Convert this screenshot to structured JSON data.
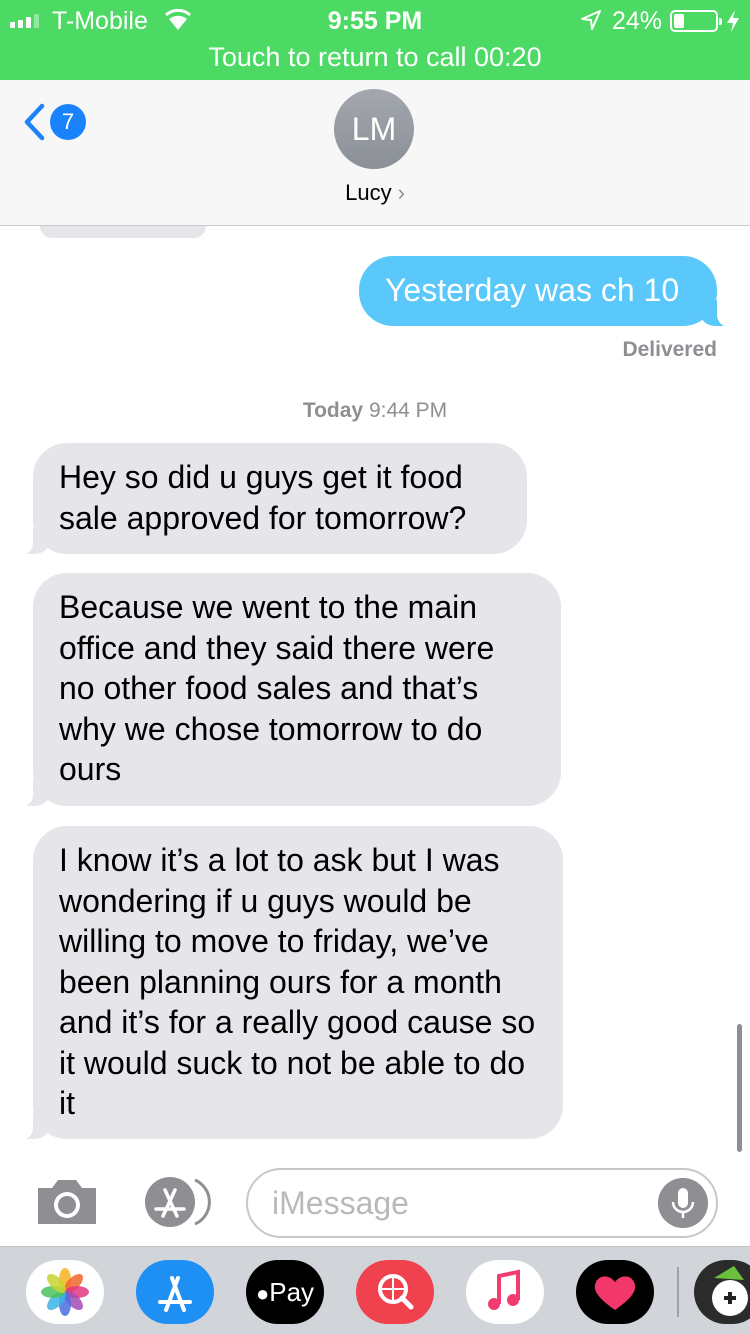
{
  "status_bar": {
    "carrier": "T-Mobile",
    "time": "9:55 PM",
    "battery_percent": "24%",
    "battery_level": 0.24,
    "signal_bars": 3,
    "charging": true
  },
  "call_banner": {
    "text": "Touch to return to call 00:20"
  },
  "header": {
    "back_badge_count": "7",
    "avatar_initials": "LM",
    "contact_name": "Lucy",
    "contact_chevron": "›"
  },
  "messages": {
    "outgoing_1": "Yesterday was ch 10",
    "delivered_status": "Delivered",
    "date_day": "Today",
    "date_time": "9:44 PM",
    "incoming_1": "Hey so did u guys get it food sale  approved for tomorrow?",
    "incoming_2": "Because we went to the main office and they said there were no other food sales and that’s why we chose tomorrow to do ours",
    "incoming_3": "I know it’s a lot to ask but I was wondering if u guys would be willing to move to friday, we’ve been planning ours for a month and it’s for a really good cause so it would suck to not be able to do it"
  },
  "compose": {
    "placeholder": "iMessage",
    "camera_icon": "camera-icon",
    "apps_icon": "app-store-icon",
    "mic_icon": "microphone-icon"
  },
  "app_drawer": {
    "apple_pay_label": "Pay",
    "apps": [
      "photos-icon",
      "app-store-icon",
      "apple-pay-icon",
      "search-images-icon",
      "music-icon",
      "digital-touch-icon",
      "game-app-icon"
    ]
  },
  "colors": {
    "status_green": "#4CD964",
    "outgoing_bubble": "#5AC8FA",
    "incoming_bubble": "#E5E5EA",
    "badge_blue": "#1A82FB"
  }
}
